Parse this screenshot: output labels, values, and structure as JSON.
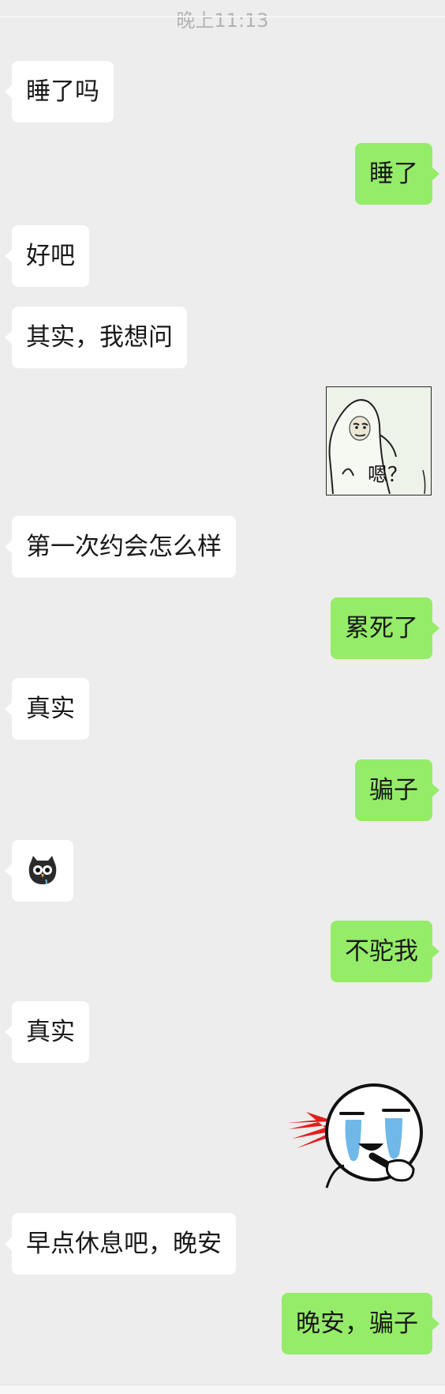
{
  "timestamp": "晚上11:13",
  "messages": [
    {
      "side": "in",
      "text": "睡了吗"
    },
    {
      "side": "out",
      "text": "睡了"
    },
    {
      "side": "in",
      "text": "好吧"
    },
    {
      "side": "in",
      "text": "其实，我想问"
    },
    {
      "side": "out",
      "sticker": "ghost-sticker",
      "text": "嗯？"
    },
    {
      "side": "in",
      "text": "第一次约会怎么样"
    },
    {
      "side": "out",
      "text": "累死了"
    },
    {
      "side": "in",
      "text": "真实"
    },
    {
      "side": "out",
      "text": "骗子"
    },
    {
      "side": "in",
      "emoji": "owl-emoji"
    },
    {
      "side": "out",
      "text": "不驼我"
    },
    {
      "side": "in",
      "text": "真实"
    },
    {
      "side": "out",
      "sticker": "crying-shot-sticker"
    },
    {
      "side": "in",
      "text": "早点休息吧，晚安"
    },
    {
      "side": "out",
      "text": "晚安，骗子"
    }
  ],
  "colors": {
    "background": "#ededed",
    "incoming_bubble": "#ffffff",
    "outgoing_bubble": "#95ec69",
    "text": "#191919"
  }
}
